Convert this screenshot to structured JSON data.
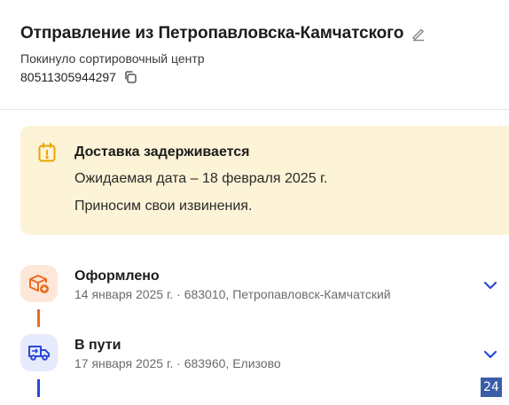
{
  "header": {
    "title": "Отправление из Петропавловска-Камчатского",
    "subtitle": "Покинуло сортировочный центр",
    "tracking_number": "80511305944297"
  },
  "alert": {
    "title": "Доставка задерживается",
    "expected": "Ожидаемая дата – 18 февраля 2025 г.",
    "apology": "Приносим свои извинения.",
    "icon": "calendar-warning-icon",
    "background": "#fdf3d6",
    "accent": "#e9a400"
  },
  "timeline": [
    {
      "title": "Оформлено",
      "meta": "14 января 2025 г. · 683010, Петропавловск-Камчатский",
      "icon": "package-add-icon",
      "accent": "#ee6b1f",
      "icon_bg": "#fde7d8"
    },
    {
      "title": "В пути",
      "meta": "17 января 2025 г. · 683960, Елизово",
      "icon": "truck-icon",
      "accent": "#2a48d6",
      "icon_bg": "#e6eafb"
    }
  ],
  "corner_badge": "24"
}
